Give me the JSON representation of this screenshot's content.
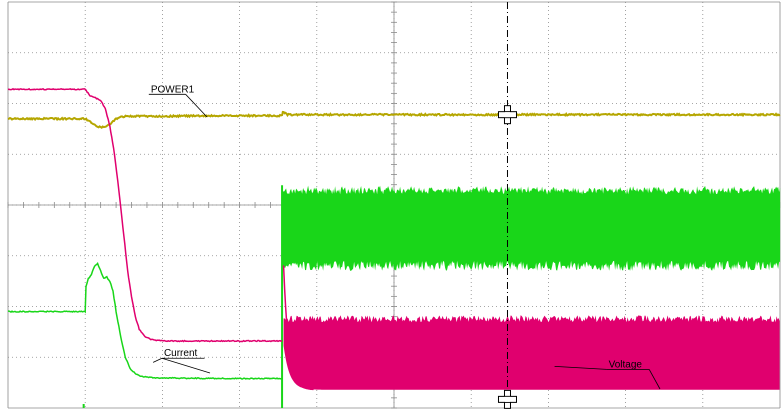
{
  "chart_data": {
    "type": "line",
    "title": "",
    "xlabel": "",
    "ylabel": "",
    "grid": true,
    "divisions": {
      "x": 10,
      "y": 8
    },
    "xlim": [
      0,
      10
    ],
    "ylim": [
      0,
      8
    ],
    "cursor_x": 6.47,
    "marker_x": 0.98,
    "colors": {
      "grid": "#8a8a8a",
      "power": "#b5a600",
      "voltage": "#e0006e",
      "current": "#19d619",
      "cursor": "#000000"
    },
    "series": [
      {
        "name": "POWER1",
        "x": [
          0,
          1.0,
          1.08,
          1.16,
          1.24,
          1.32,
          1.4,
          1.48,
          1.55,
          2.0,
          3.0,
          3.55,
          3.56,
          3.62,
          10
        ],
        "y": [
          5.7,
          5.7,
          5.62,
          5.55,
          5.53,
          5.59,
          5.7,
          5.74,
          5.75,
          5.75,
          5.76,
          5.76,
          5.84,
          5.78,
          5.78
        ],
        "label_x": 1.85,
        "label_y": 6.22
      },
      {
        "name": "Voltage",
        "x": [
          0,
          1.0,
          1.06,
          1.12,
          1.2,
          1.26,
          1.32,
          1.38,
          1.45,
          1.5,
          1.55,
          1.6,
          1.65,
          1.7,
          1.78,
          1.85,
          1.92,
          2.0,
          2.1,
          2.3,
          3.0,
          3.55
        ],
        "y": [
          6.28,
          6.28,
          6.16,
          6.12,
          6.06,
          5.9,
          5.55,
          5.0,
          4.1,
          3.4,
          2.7,
          2.2,
          1.8,
          1.55,
          1.4,
          1.35,
          1.33,
          1.33,
          1.32,
          1.32,
          1.32,
          1.32
        ],
        "label_x": 7.78,
        "label_y": 0.8
      },
      {
        "name": "Current",
        "x": [
          0,
          0.99,
          1.0,
          1.01,
          1.04,
          1.08,
          1.12,
          1.16,
          1.2,
          1.24,
          1.28,
          1.32,
          1.36,
          1.4,
          1.46,
          1.52,
          1.58,
          1.66,
          1.74,
          1.85,
          2.0,
          3.0,
          3.55
        ],
        "y": [
          1.9,
          1.9,
          1.9,
          2.4,
          2.55,
          2.62,
          2.8,
          2.85,
          2.7,
          2.55,
          2.58,
          2.5,
          2.3,
          1.9,
          1.4,
          1.0,
          0.78,
          0.66,
          0.62,
          0.6,
          0.59,
          0.58,
          0.58
        ],
        "label_x": 2.02,
        "label_y": 1.02
      }
    ],
    "bands": [
      {
        "name": "Current",
        "color_key": "current",
        "x_start": 3.55,
        "x_end": 10,
        "upper": 4.35,
        "lower": 2.8,
        "settle_to": 2.8
      },
      {
        "name": "Voltage",
        "color_key": "voltage",
        "x_start": 3.57,
        "x_end": 10,
        "upper": 1.8,
        "lower": 0.36,
        "settle_to": 0.36
      }
    ]
  }
}
